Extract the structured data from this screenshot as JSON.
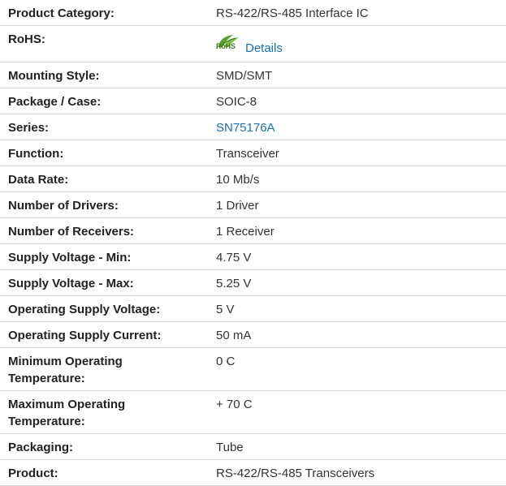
{
  "specs": [
    {
      "label": "Product Category:",
      "value": "RS-422/RS-485 Interface IC"
    },
    {
      "label": "RoHS:",
      "icon_text": "RoHS",
      "icon": "rohs-leaf-icon",
      "value": "Details"
    },
    {
      "label": "Mounting Style:",
      "value": "SMD/SMT"
    },
    {
      "label": "Package / Case:",
      "value": "SOIC-8"
    },
    {
      "label": "Series:",
      "value": "SN75176A"
    },
    {
      "label": "Function:",
      "value": "Transceiver"
    },
    {
      "label": "Data Rate:",
      "value": "10 Mb/s"
    },
    {
      "label": "Number of Drivers:",
      "value": "1 Driver"
    },
    {
      "label": "Number of Receivers:",
      "value": "1 Receiver"
    },
    {
      "label": "Supply Voltage - Min:",
      "value": "4.75 V"
    },
    {
      "label": "Supply Voltage - Max:",
      "value": "5.25 V"
    },
    {
      "label": "Operating Supply Voltage:",
      "value": "5 V"
    },
    {
      "label": "Operating Supply Current:",
      "value": "50 mA"
    },
    {
      "label": "Minimum Operating Temperature:",
      "value": "0 C"
    },
    {
      "label": "Maximum Operating Temperature:",
      "value": "+ 70 C"
    },
    {
      "label": "Packaging:",
      "value": "Tube"
    },
    {
      "label": "Product:",
      "value": "RS-422/RS-485 Transceivers"
    }
  ],
  "colors": {
    "link": "#1a6fb5",
    "label_text": "#222222",
    "value_text": "#333333",
    "divider": "#d6d6d6",
    "rohs_green": "#3c7a1e"
  }
}
